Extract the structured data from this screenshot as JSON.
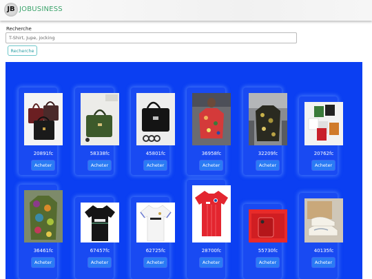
{
  "header": {
    "logo_text": "JB",
    "brand_text": "JOBUSINESS"
  },
  "search": {
    "label": "Recherche",
    "placeholder": "T-Shirt, Jupe, jocking",
    "value": "",
    "button_label": "Recherche"
  },
  "colors": {
    "panel": "#0b3ff2",
    "buy_button": "#2a7bf4",
    "brand": "#3aa36a"
  },
  "products": [
    {
      "name": "sac-rouge-bordeaux",
      "price": "20891fc",
      "buy_label": "Acheter"
    },
    {
      "name": "sac-vert",
      "price": "58338fc",
      "buy_label": "Acheter"
    },
    {
      "name": "sac-noir",
      "price": "45801fc",
      "buy_label": "Acheter"
    },
    {
      "name": "chemise-fleurie",
      "price": "36958fc",
      "buy_label": "Acheter"
    },
    {
      "name": "chemise-motifs",
      "price": "32209fc",
      "buy_label": "Acheter"
    },
    {
      "name": "bonnets",
      "price": "20762fc",
      "buy_label": "Acheter"
    },
    {
      "name": "chemise-africaine",
      "price": "36461fc",
      "buy_label": "Acheter"
    },
    {
      "name": "maillot-arsenal-noir",
      "price": "67457fc",
      "buy_label": "Acheter"
    },
    {
      "name": "maillot-real-madrid",
      "price": "62725fc",
      "buy_label": "Acheter"
    },
    {
      "name": "maillot-bayern",
      "price": "28700fc",
      "buy_label": "Acheter"
    },
    {
      "name": "iphone-rouge",
      "price": "55730fc",
      "buy_label": "Acheter"
    },
    {
      "name": "baskets-nike",
      "price": "40135fc",
      "buy_label": "Acheter"
    }
  ]
}
